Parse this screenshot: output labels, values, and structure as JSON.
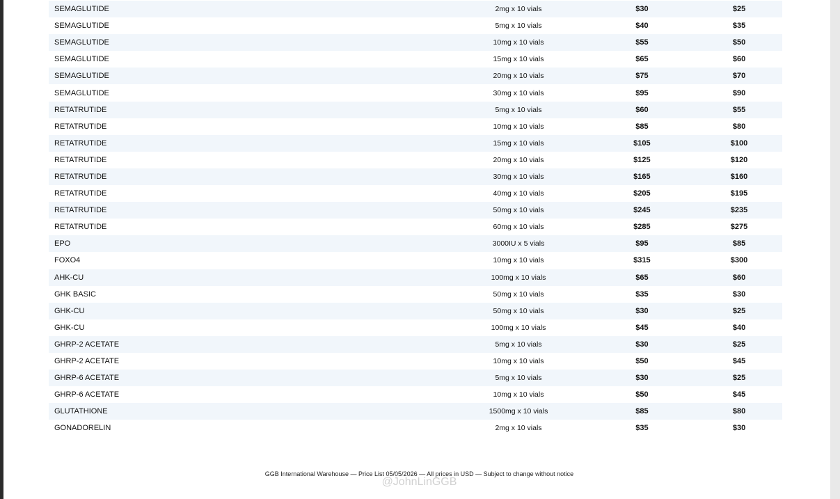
{
  "products": [
    {
      "name": "SEMAGLUTIDE",
      "size": "2mg x 10 vials",
      "price1": "$30",
      "price2": "$25"
    },
    {
      "name": "SEMAGLUTIDE",
      "size": "5mg x 10 vials",
      "price1": "$40",
      "price2": "$35"
    },
    {
      "name": "SEMAGLUTIDE",
      "size": "10mg x 10 vials",
      "price1": "$55",
      "price2": "$50"
    },
    {
      "name": "SEMAGLUTIDE",
      "size": "15mg x 10 vials",
      "price1": "$65",
      "price2": "$60"
    },
    {
      "name": "SEMAGLUTIDE",
      "size": "20mg x 10 vials",
      "price1": "$75",
      "price2": "$70"
    },
    {
      "name": "SEMAGLUTIDE",
      "size": "30mg x 10 vials",
      "price1": "$95",
      "price2": "$90"
    },
    {
      "name": "RETATRUTIDE",
      "size": "5mg x 10 vials",
      "price1": "$60",
      "price2": "$55"
    },
    {
      "name": "RETATRUTIDE",
      "size": "10mg x 10 vials",
      "price1": "$85",
      "price2": "$80"
    },
    {
      "name": "RETATRUTIDE",
      "size": "15mg x 10 vials",
      "price1": "$105",
      "price2": "$100"
    },
    {
      "name": "RETATRUTIDE",
      "size": "20mg x 10 vials",
      "price1": "$125",
      "price2": "$120"
    },
    {
      "name": "RETATRUTIDE",
      "size": "30mg x 10 vials",
      "price1": "$165",
      "price2": "$160"
    },
    {
      "name": "RETATRUTIDE",
      "size": "40mg x 10 vials",
      "price1": "$205",
      "price2": "$195"
    },
    {
      "name": "RETATRUTIDE",
      "size": "50mg x 10 vials",
      "price1": "$245",
      "price2": "$235"
    },
    {
      "name": "RETATRUTIDE",
      "size": "60mg x 10 vials",
      "price1": "$285",
      "price2": "$275"
    },
    {
      "name": "EPO",
      "size": "3000IU x 5 vials",
      "price1": "$95",
      "price2": "$85"
    },
    {
      "name": "FOXO4",
      "size": "10mg x 10 vials",
      "price1": "$315",
      "price2": "$300"
    },
    {
      "name": "AHK-CU",
      "size": "100mg x 10 vials",
      "price1": "$65",
      "price2": "$60"
    },
    {
      "name": "GHK BASIC",
      "size": "50mg x 10 vials",
      "price1": "$35",
      "price2": "$30"
    },
    {
      "name": "GHK-CU",
      "size": "50mg x 10 vials",
      "price1": "$30",
      "price2": "$25"
    },
    {
      "name": "GHK-CU",
      "size": "100mg x 10 vials",
      "price1": "$45",
      "price2": "$40"
    },
    {
      "name": "GHRP-2 ACETATE",
      "size": "5mg x 10 vials",
      "price1": "$30",
      "price2": "$25"
    },
    {
      "name": "GHRP-2 ACETATE",
      "size": "10mg x 10 vials",
      "price1": "$50",
      "price2": "$45"
    },
    {
      "name": "GHRP-6 ACETATE",
      "size": "5mg x 10 vials",
      "price1": "$30",
      "price2": "$25"
    },
    {
      "name": "GHRP-6 ACETATE",
      "size": "10mg x 10 vials",
      "price1": "$50",
      "price2": "$45"
    },
    {
      "name": "GLUTATHIONE",
      "size": "1500mg x 10 vials",
      "price1": "$85",
      "price2": "$80"
    },
    {
      "name": "GONADORELIN",
      "size": "2mg x 10 vials",
      "price1": "$35",
      "price2": "$30"
    }
  ],
  "footer": {
    "text": "GGB International Warehouse — Price List 05/05/2026 — All prices in USD — Subject to change without notice",
    "watermark": "@JohnLinGGB"
  },
  "colors": {
    "stripe": "#f1f6fb",
    "background": "#2b2b2b"
  }
}
